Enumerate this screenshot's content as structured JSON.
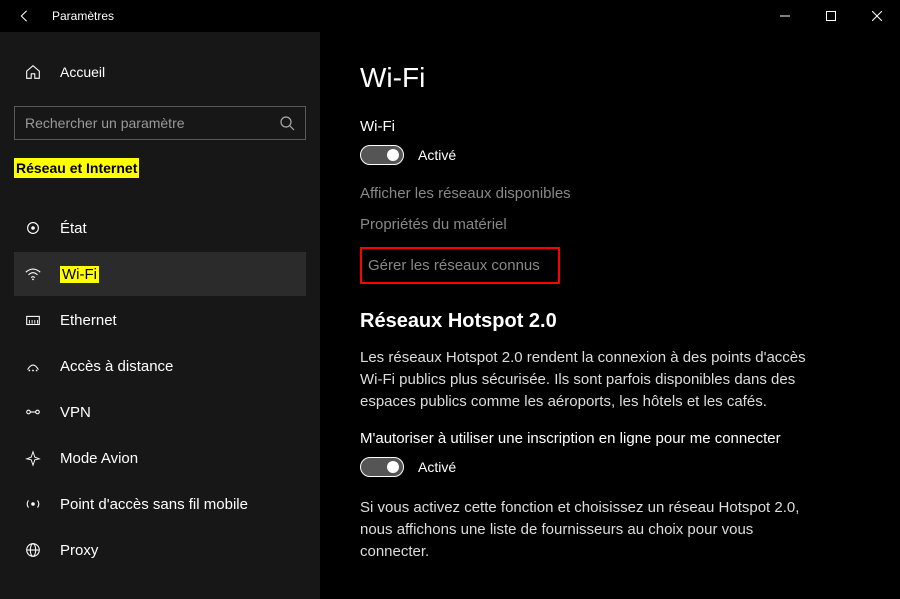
{
  "titlebar": {
    "title": "Paramètres"
  },
  "sidebar": {
    "home": "Accueil",
    "search_placeholder": "Rechercher un paramètre",
    "category": "Réseau et Internet",
    "items": [
      {
        "label": "État"
      },
      {
        "label": "Wi-Fi"
      },
      {
        "label": "Ethernet"
      },
      {
        "label": "Accès à distance"
      },
      {
        "label": "VPN"
      },
      {
        "label": "Mode Avion"
      },
      {
        "label": "Point d'accès sans fil mobile"
      },
      {
        "label": "Proxy"
      }
    ]
  },
  "content": {
    "page_title": "Wi-Fi",
    "wifi_label": "Wi-Fi",
    "wifi_toggle_state": "Activé",
    "link_show_networks": "Afficher les réseaux disponibles",
    "link_hw_props": "Propriétés du matériel",
    "link_manage_known": "Gérer les réseaux connus",
    "hotspot": {
      "title": "Réseaux Hotspot 2.0",
      "desc": "Les réseaux Hotspot 2.0 rendent la connexion à des points d'accès Wi-Fi publics plus sécurisée. Ils sont parfois disponibles dans des espaces publics comme les aéroports, les hôtels et les cafés.",
      "auth_label": "M'autoriser à utiliser une inscription en ligne pour me connecter",
      "auth_toggle_state": "Activé",
      "note": "Si vous activez cette fonction et choisissez un réseau Hotspot 2.0, nous affichons une liste de fournisseurs au choix pour vous connecter."
    }
  }
}
